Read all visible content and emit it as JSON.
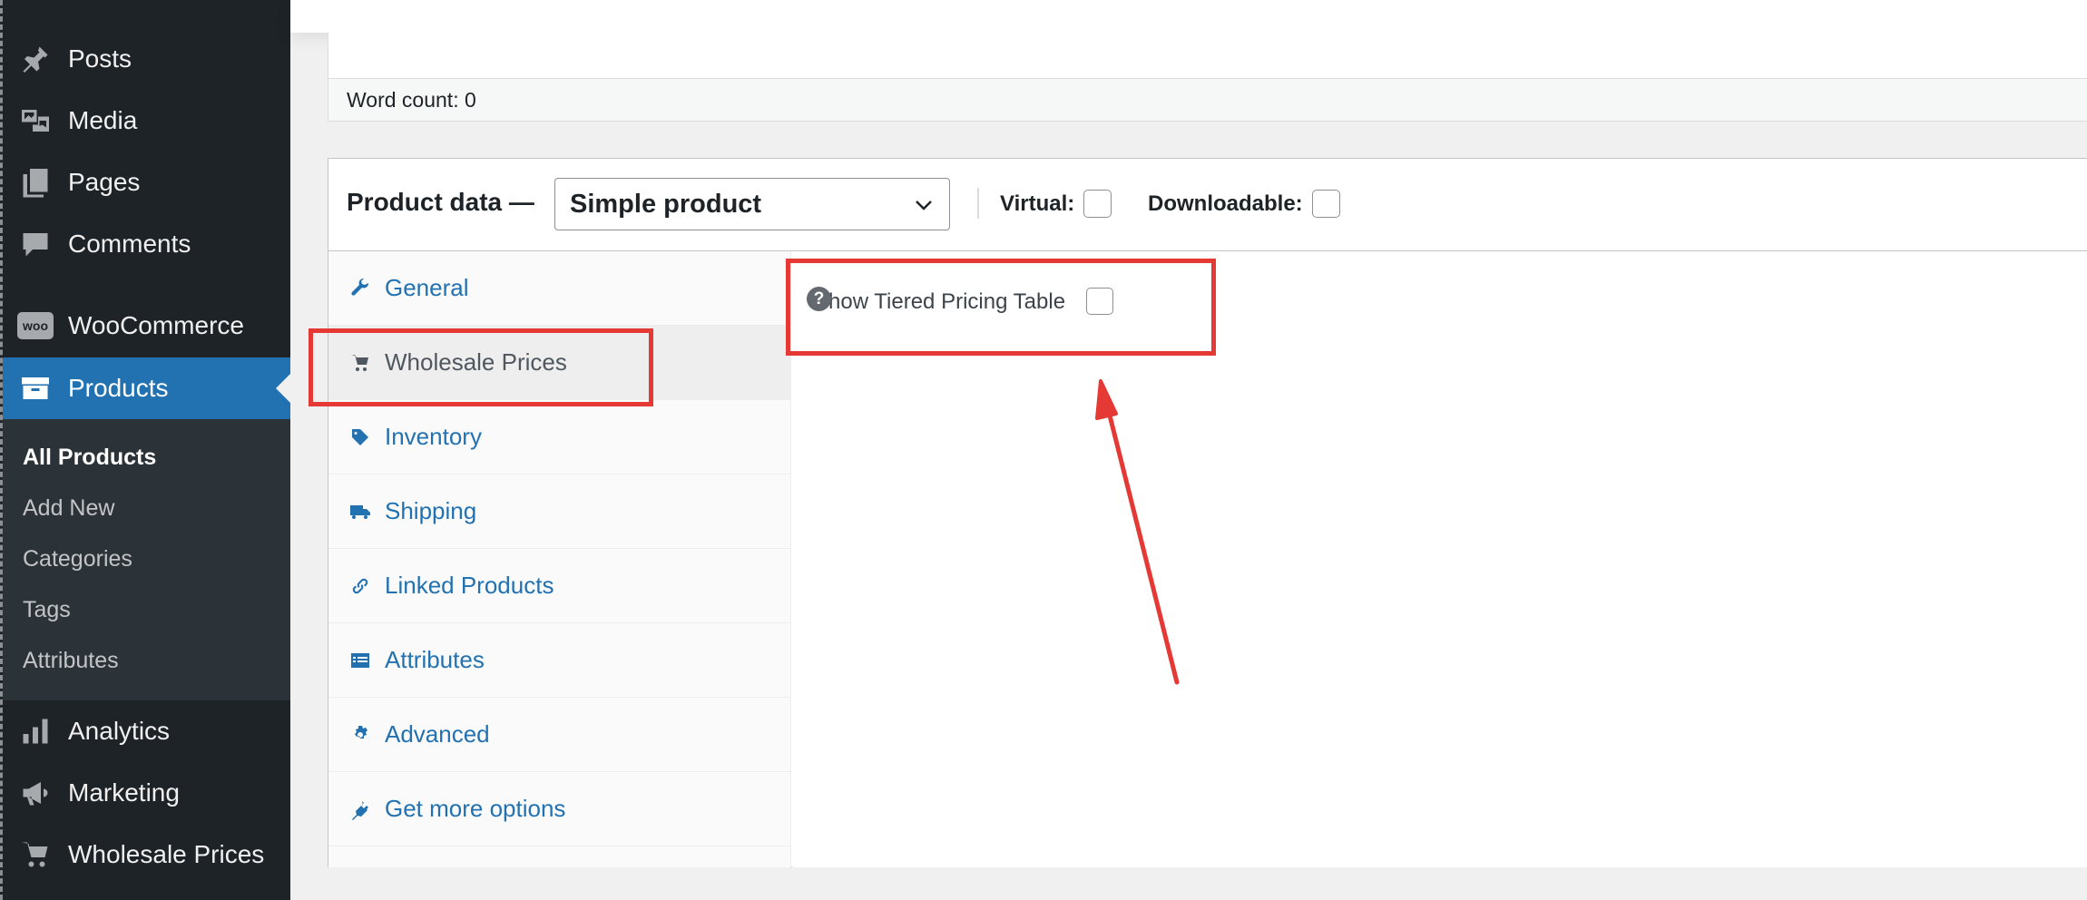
{
  "sidebar": {
    "items": [
      {
        "label": "Posts",
        "icon": "pin-icon"
      },
      {
        "label": "Media",
        "icon": "media-icon"
      },
      {
        "label": "Pages",
        "icon": "pages-icon"
      },
      {
        "label": "Comments",
        "icon": "comment-icon"
      },
      {
        "label": "WooCommerce",
        "icon": "woo-icon"
      },
      {
        "label": "Products",
        "icon": "archive-icon",
        "active": true
      },
      {
        "label": "Analytics",
        "icon": "bar-chart-icon"
      },
      {
        "label": "Marketing",
        "icon": "megaphone-icon"
      },
      {
        "label": "Wholesale Prices",
        "icon": "cart-icon"
      }
    ],
    "woo_badge": "woo",
    "submenu": [
      {
        "label": "All Products",
        "current": true
      },
      {
        "label": "Add New"
      },
      {
        "label": "Categories"
      },
      {
        "label": "Tags"
      },
      {
        "label": "Attributes"
      }
    ]
  },
  "editor": {
    "word_count": "Word count: 0"
  },
  "product_data": {
    "title": "Product data —",
    "type_select": "Simple product",
    "virtual_label": "Virtual:",
    "downloadable_label": "Downloadable:",
    "tabs": [
      {
        "label": "General",
        "icon": "wrench-icon"
      },
      {
        "label": "Wholesale Prices",
        "icon": "cart-icon",
        "active": true
      },
      {
        "label": "Inventory",
        "icon": "tag-icon"
      },
      {
        "label": "Shipping",
        "icon": "truck-icon"
      },
      {
        "label": "Linked Products",
        "icon": "link-icon"
      },
      {
        "label": "Attributes",
        "icon": "list-icon"
      },
      {
        "label": "Advanced",
        "icon": "gear-icon"
      },
      {
        "label": "Get more options",
        "icon": "plugin-icon"
      }
    ],
    "panel": {
      "tier_label": "Show Tiered Pricing Table",
      "help": "?"
    }
  },
  "colors": {
    "admin_bar": "#1d2327",
    "accent": "#2271b1",
    "annotation": "#e53935"
  }
}
